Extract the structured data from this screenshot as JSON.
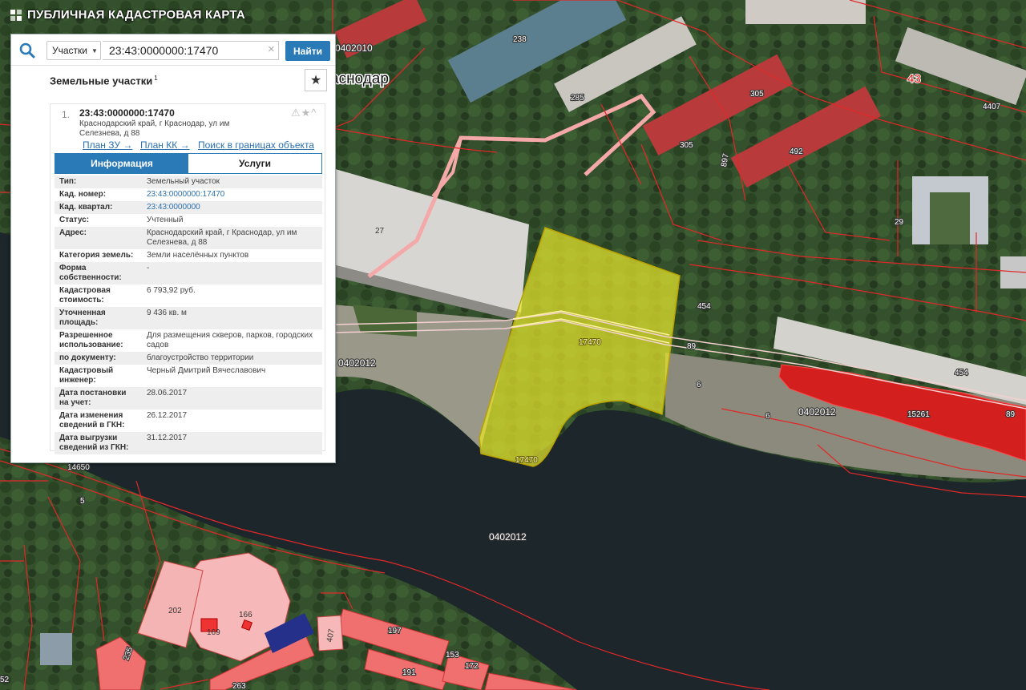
{
  "app": {
    "title": "ПУБЛИЧНАЯ КАДАСТРОВАЯ КАРТА"
  },
  "search": {
    "type": "Участки",
    "value": "23:43:0000000:17470",
    "clear": "×",
    "button": "Найти"
  },
  "results": {
    "title": "Земельные участки",
    "count": "1",
    "fav_icon": "★"
  },
  "card": {
    "index": "1.",
    "number": "23:43:0000000:17470",
    "address": "Краснодарский край, г Краснодар, ул им Селезнева, д 88",
    "icons": "⚠★^",
    "links": [
      "План ЗУ →",
      "План КК →",
      "Поиск в границах объекта →"
    ],
    "tabs": [
      "Информация",
      "Услуги"
    ],
    "info": [
      {
        "label": "Тип:",
        "value": "Земельный участок"
      },
      {
        "label": "Кад. номер:",
        "value": "23:43:0000000:17470"
      },
      {
        "label": "Кад. квартал:",
        "value": "23:43:0000000"
      },
      {
        "label": "Статус:",
        "value": "Учтенный"
      },
      {
        "label": "Адрес:",
        "value": "Краснодарский край, г Краснодар, ул им Селезнева, д 88"
      },
      {
        "label": "Категория земель:",
        "value": "Земли населённых пунктов"
      },
      {
        "label": "Форма собственности:",
        "value": "-"
      },
      {
        "label": "Кадастровая стоимость:",
        "value": "6 793,92 руб."
      },
      {
        "label": "Уточненная площадь:",
        "value": "9 436 кв. м"
      },
      {
        "label": "Разрешенное использование:",
        "value": "Для размещения скверов, парков, городских садов"
      },
      {
        "label": "по документу:",
        "value": "благоустройство территории"
      },
      {
        "label": "Кадастровый инженер:",
        "value": "Черный Дмитрий Вячеславович"
      },
      {
        "label": "Дата постановки на учет:",
        "value": "28.06.2017"
      },
      {
        "label": "Дата изменения сведений в ГКН:",
        "value": "26.12.2017"
      },
      {
        "label": "Дата выгрузки сведений из ГКН:",
        "value": "31.12.2017"
      }
    ]
  },
  "map": {
    "city": "аснодар",
    "quarters": [
      "0402010",
      "0402012",
      "0402012",
      "0402012"
    ],
    "big": "43",
    "labels": [
      "238",
      "285",
      "305",
      "305",
      "492",
      "897",
      "4407",
      "29",
      "27",
      "454",
      "89",
      "6",
      "6",
      "454",
      "15261",
      "89",
      "14650",
      "5",
      "202",
      "166",
      "169",
      "235",
      "263",
      "191",
      "197",
      "172",
      "153",
      "407",
      "52",
      "17470",
      "17470"
    ]
  },
  "colors": {
    "accent": "#2a7ab8",
    "parcel": "#e8e82a",
    "water": "#1a2428",
    "boundary": "#d42020"
  }
}
